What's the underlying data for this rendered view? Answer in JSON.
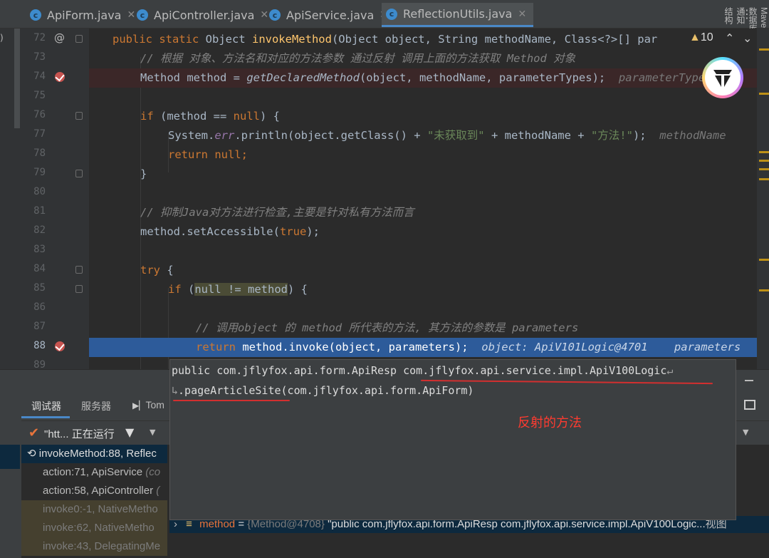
{
  "tabs": [
    {
      "label": "ApiForm.java",
      "active": false
    },
    {
      "label": "ApiController.java",
      "active": false
    },
    {
      "label": "ApiService.java",
      "active": false
    },
    {
      "label": "ReflectionUtils.java",
      "active": true
    }
  ],
  "tab_icon_letter": "c",
  "warnings": {
    "count": "10"
  },
  "right_tools": [
    "Maven",
    "数据库",
    "通知",
    "结构"
  ],
  "gutter": {
    "line_numbers": [
      "72",
      "73",
      "74",
      "75",
      "76",
      "77",
      "78",
      "79",
      "80",
      "81",
      "82",
      "83",
      "84",
      "85",
      "86",
      "87",
      "88",
      "89"
    ]
  },
  "code": {
    "l72": {
      "a": "public static ",
      "b": "Object ",
      "c": "invokeMethod",
      "d": "(Object object, String methodName, Class<?>[] par"
    },
    "l73": "// 根据 对象、方法名和对应的方法参数 通过反射 调用上面的方法获取 Method 对象",
    "l74": {
      "a": "Method method = ",
      "b": "getDeclaredMethod",
      "c": "(object, methodName, parameterTypes);",
      "hint": "parameterTypes:"
    },
    "l76": {
      "a": "if ",
      "b": "(method == ",
      "c": "null",
      "d": ") {"
    },
    "l77": {
      "a": "System.",
      "b": "err",
      "c": ".println(object.getClass() + ",
      "d": "\"未获取到\"",
      "e": " + methodName + ",
      "f": "\"方法!\"",
      "g": ");",
      "hint": "methodName"
    },
    "l78": {
      "a": "return ",
      "b": "null",
      "c": ";"
    },
    "l79": "}",
    "l81": "// 抑制Java对方法进行检查,主要是针对私有方法而言",
    "l82": {
      "a": "method.setAccessible(",
      "b": "true",
      "c": ");"
    },
    "l84": {
      "a": "try ",
      "b": "{"
    },
    "l85": {
      "a": "if ",
      "b": "(",
      "c": "null != method",
      "d": ") {"
    },
    "l87": "// 调用object 的 method 所代表的方法, 其方法的参数是 parameters",
    "l88": {
      "a": "return ",
      "b": "method.invoke(object, parameters);",
      "hint1": "object: ApiV101Logic@4701",
      "hint2": "parameters"
    }
  },
  "popup": {
    "line1_a": "public com.jflyfox.api.form.ApiResp ",
    "line1_b": "com.jflyfox.api.service.impl.ApiV100Logic",
    "line1_wrap": "↵",
    "line2_wrap": "↳",
    "line2_a": ".pageArticleSite",
    "line2_b": "(com.jflyfox.api.form.ApiForm)",
    "annotation": "反射的方法"
  },
  "debug": {
    "tabs": [
      "调试器",
      "服务器",
      "Tom"
    ],
    "thread_label": "\"htt...",
    "thread_status": "正在运行",
    "frames": [
      {
        "name": "invokeMethod:88, Reflec",
        "loc": "",
        "selected": true,
        "dim": false
      },
      {
        "name": "action:71, ApiService ",
        "loc": "(co",
        "selected": false,
        "dim": false
      },
      {
        "name": "action:58, ApiController ",
        "loc": "(",
        "selected": false,
        "dim": false
      },
      {
        "name": "invoke0:-1, NativeMetho",
        "loc": "",
        "selected": false,
        "dim": true
      },
      {
        "name": "invoke:62, NativeMetho",
        "loc": "",
        "selected": false,
        "dim": true
      },
      {
        "name": "invoke:43, DelegatingMe",
        "loc": "",
        "selected": false,
        "dim": true
      }
    ],
    "variable": {
      "name": "method",
      "eq": " = ",
      "obj": "{Method@4708}",
      "value": " \"public com.jflyfox.api.form.ApiResp com.jflyfox.api.service.impl.ApiV100Logic...",
      "view_link": "视图"
    }
  },
  "colors": {
    "accent": "#4a88c7",
    "breakpoint": "#c75450",
    "exec_line": "#2d5b9a",
    "annotation": "#ff3b30",
    "keyword": "#cc7832",
    "string": "#6a8759",
    "comment": "#808080"
  },
  "icons": [
    "at-icon",
    "breakpoint-icon",
    "fold-icon",
    "warning-icon",
    "chevron-up-icon",
    "chevron-down-icon",
    "tab-menu-icon",
    "check-icon",
    "filter-icon",
    "dropdown-icon",
    "layout-icon",
    "minimize-icon",
    "expand-icon",
    "field-icon",
    "restore-icon",
    "plugin-logo-icon",
    "java-class-icon",
    "close-icon"
  ]
}
